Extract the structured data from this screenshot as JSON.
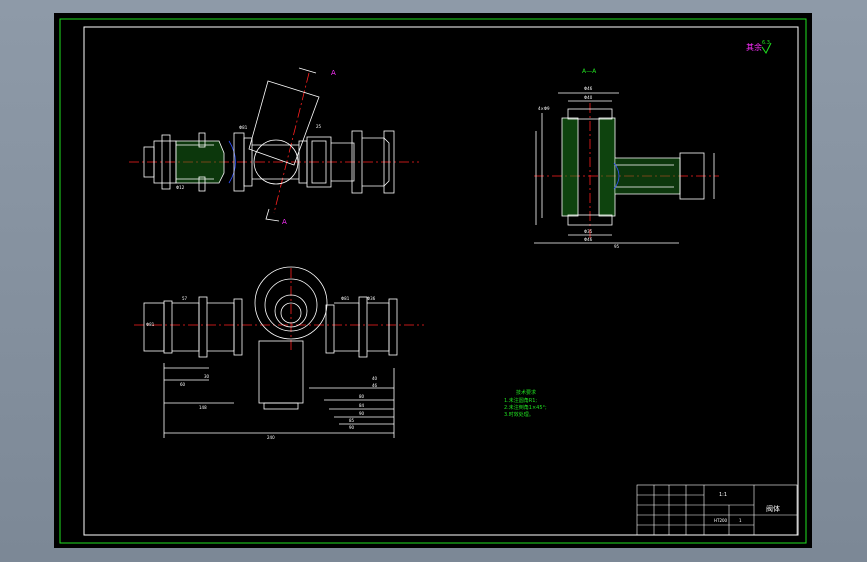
{
  "drawing": {
    "roughness_label": "其余",
    "roughness_value": "6.3",
    "section_label_top": "A",
    "section_label_bottom": "A",
    "section_view_title": "A—A",
    "dims_front": {
      "d1": "Φ81",
      "d2": "25",
      "d3": "Φ12"
    },
    "dims_section": {
      "top": "Φ46",
      "top2": "Φ40",
      "left_dim": "4×Φ9",
      "bottom": "Φ35",
      "bottom2": "Φ46",
      "overall": "95"
    },
    "dims_bottom": {
      "a": "57",
      "b": "30",
      "c": "60",
      "d": "148",
      "e": "240",
      "f": "40",
      "g": "46",
      "h": "80",
      "i": "84",
      "j": "90",
      "k": "85",
      "l": "90",
      "left": "Φ81",
      "r1": "Φ81",
      "r2": "Φ36"
    },
    "notes": {
      "title": "技术要求",
      "line1": "1.未注圆角R1;",
      "line2": "2.未注倒角1×45°;",
      "line3": "3.时效处理。"
    },
    "title_block": {
      "scale": "1:1",
      "part_name": "阀体",
      "material": "HT200",
      "count": "1"
    }
  },
  "colors": {
    "line": "#ffffff",
    "center": "#ff2020",
    "hatch": "#20c020",
    "border": "#20e020",
    "label": "#ff30ff"
  }
}
